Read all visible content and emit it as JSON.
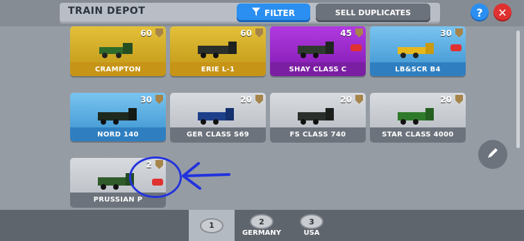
{
  "header": {
    "title": "TRAIN DEPOT",
    "filter_label": "FILTER",
    "sell_label": "SELL DUPLICATES",
    "help_label": "?",
    "close_label": "✕"
  },
  "cards": [
    {
      "name": "CRAMPTON",
      "count": "60",
      "color": "yellow"
    },
    {
      "name": "ERIE L-1",
      "count": "60",
      "color": "yellow"
    },
    {
      "name": "SHAY CLASS C",
      "count": "45",
      "color": "purple"
    },
    {
      "name": "LB&SCR B4",
      "count": "30",
      "color": "blue"
    },
    {
      "name": "NORD 140",
      "count": "30",
      "color": "blue"
    },
    {
      "name": "GER CLASS S69",
      "count": "20",
      "color": "grey"
    },
    {
      "name": "FS CLASS 740",
      "count": "20",
      "color": "grey"
    },
    {
      "name": "STAR CLASS 4000",
      "count": "20",
      "color": "grey"
    },
    {
      "name": "PRUSSIAN P",
      "count": "2",
      "color": "grey"
    }
  ],
  "tabs": [
    {
      "num": "1",
      "label": ""
    },
    {
      "num": "2",
      "label": "GERMANY"
    },
    {
      "num": "3",
      "label": "USA"
    }
  ]
}
